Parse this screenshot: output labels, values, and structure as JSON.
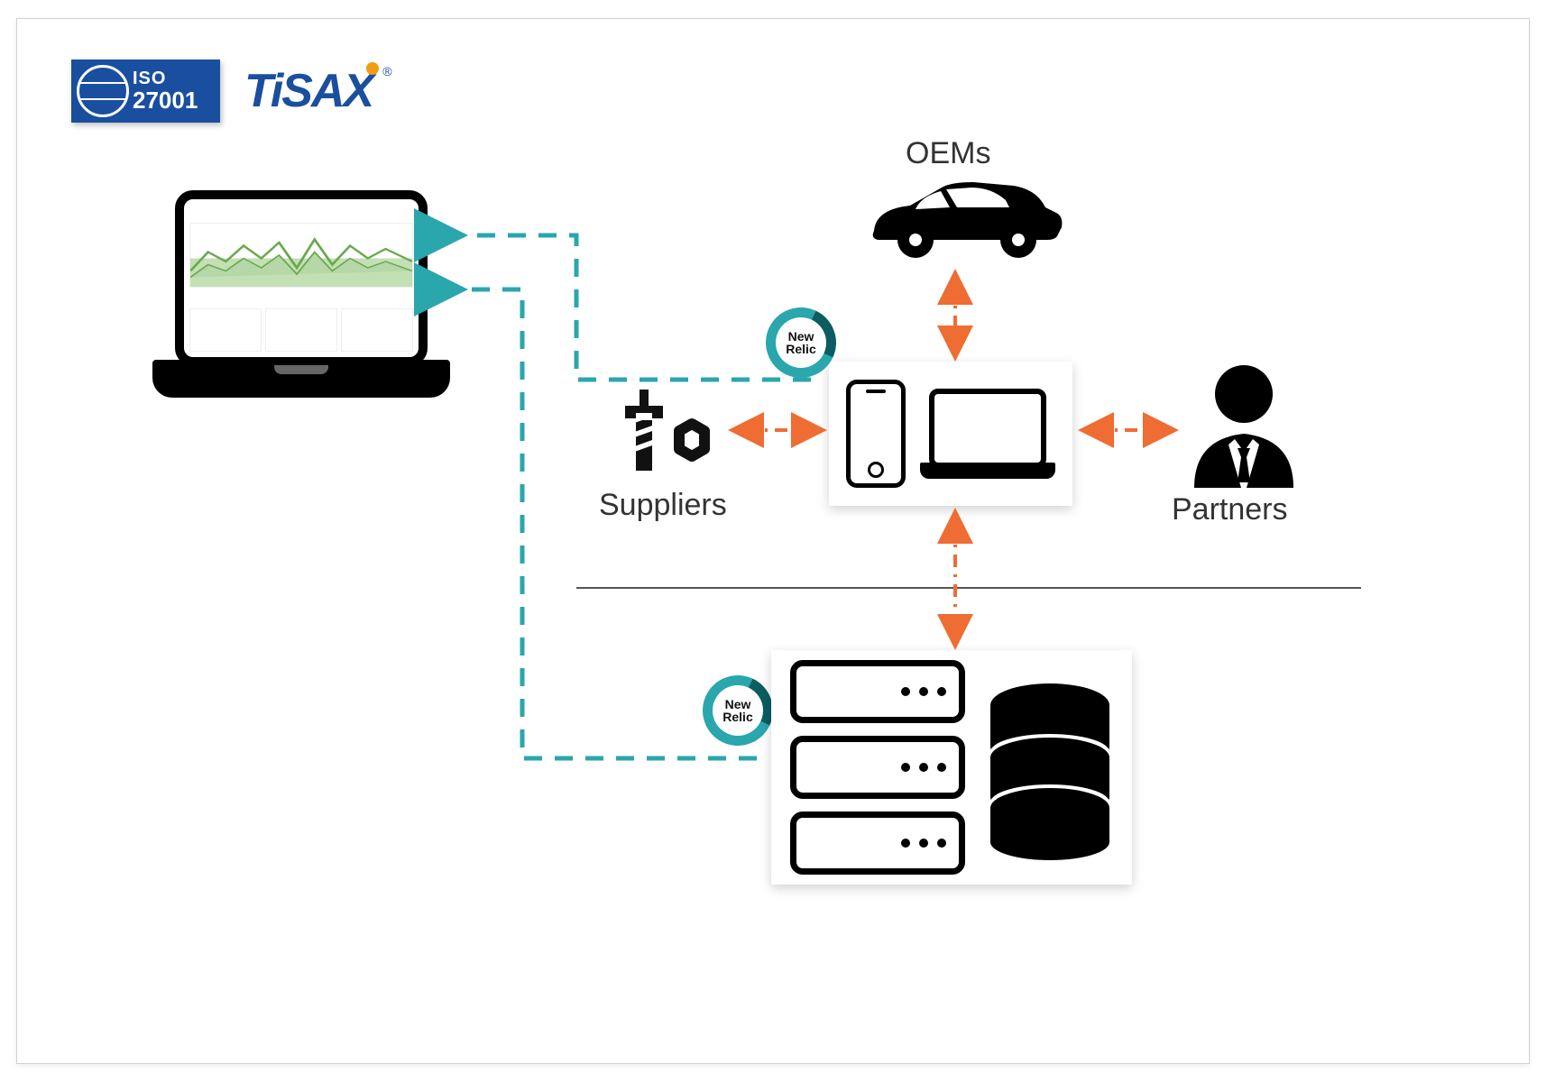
{
  "badges": {
    "iso_label": "ISO",
    "iso_number": "27001",
    "tisax": "TiSAX",
    "newrelic": "New\nRelic"
  },
  "nodes": {
    "oems": "OEMs",
    "suppliers": "Suppliers",
    "partners": "Partners"
  },
  "connections": {
    "dashed_teal": [
      "devices_to_monitoring_laptop",
      "servers_to_monitoring_laptop"
    ],
    "orange_bidirectional": [
      "oems_to_devices",
      "suppliers_to_devices",
      "partners_to_devices",
      "devices_to_servers"
    ]
  },
  "colors": {
    "teal": "#2aa6ad",
    "orange": "#ef6c33",
    "iso_blue": "#1a4fa0"
  }
}
